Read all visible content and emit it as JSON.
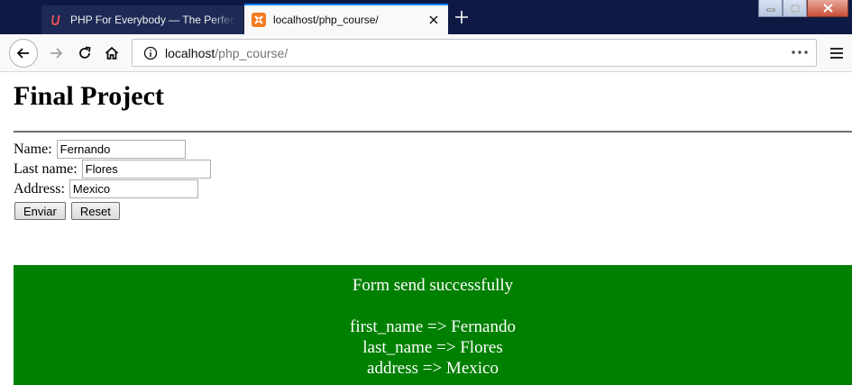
{
  "browser": {
    "tabs": [
      {
        "title": "PHP For Everybody — The Perfect",
        "favicon": "udemy-icon"
      },
      {
        "title": "localhost/php_course/",
        "favicon": "xampp-icon",
        "active": true
      }
    ],
    "url": {
      "host": "localhost",
      "path": "/php_course/"
    }
  },
  "page": {
    "heading": "Final Project",
    "form": {
      "name_label": "Name:",
      "name_value": "Fernando",
      "last_name_label": "Last name:",
      "last_name_value": "Flores",
      "address_label": "Address:",
      "address_value": "Mexico",
      "submit_label": "Enviar",
      "reset_label": "Reset"
    },
    "result": {
      "message": "Form send successfully",
      "lines": [
        "first_name => Fernando",
        "last_name => Flores",
        "address => Mexico"
      ],
      "background": "#008000"
    }
  },
  "colors": {
    "tabstrip": "#0f1a44",
    "active_tab_accent": "#0a84ff",
    "xampp_orange": "#f57b20",
    "udemy_red": "#ec5252"
  }
}
